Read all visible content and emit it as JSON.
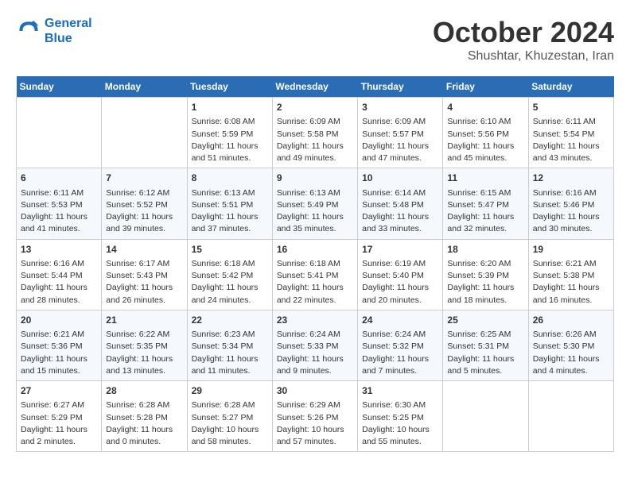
{
  "header": {
    "logo_line1": "General",
    "logo_line2": "Blue",
    "month": "October 2024",
    "location": "Shushtar, Khuzestan, Iran"
  },
  "weekdays": [
    "Sunday",
    "Monday",
    "Tuesday",
    "Wednesday",
    "Thursday",
    "Friday",
    "Saturday"
  ],
  "weeks": [
    [
      {
        "day": "",
        "empty": true
      },
      {
        "day": "",
        "empty": true
      },
      {
        "day": "1",
        "sunrise": "6:08 AM",
        "sunset": "5:59 PM",
        "daylight": "11 hours and 51 minutes."
      },
      {
        "day": "2",
        "sunrise": "6:09 AM",
        "sunset": "5:58 PM",
        "daylight": "11 hours and 49 minutes."
      },
      {
        "day": "3",
        "sunrise": "6:09 AM",
        "sunset": "5:57 PM",
        "daylight": "11 hours and 47 minutes."
      },
      {
        "day": "4",
        "sunrise": "6:10 AM",
        "sunset": "5:56 PM",
        "daylight": "11 hours and 45 minutes."
      },
      {
        "day": "5",
        "sunrise": "6:11 AM",
        "sunset": "5:54 PM",
        "daylight": "11 hours and 43 minutes."
      }
    ],
    [
      {
        "day": "6",
        "sunrise": "6:11 AM",
        "sunset": "5:53 PM",
        "daylight": "11 hours and 41 minutes."
      },
      {
        "day": "7",
        "sunrise": "6:12 AM",
        "sunset": "5:52 PM",
        "daylight": "11 hours and 39 minutes."
      },
      {
        "day": "8",
        "sunrise": "6:13 AM",
        "sunset": "5:51 PM",
        "daylight": "11 hours and 37 minutes."
      },
      {
        "day": "9",
        "sunrise": "6:13 AM",
        "sunset": "5:49 PM",
        "daylight": "11 hours and 35 minutes."
      },
      {
        "day": "10",
        "sunrise": "6:14 AM",
        "sunset": "5:48 PM",
        "daylight": "11 hours and 33 minutes."
      },
      {
        "day": "11",
        "sunrise": "6:15 AM",
        "sunset": "5:47 PM",
        "daylight": "11 hours and 32 minutes."
      },
      {
        "day": "12",
        "sunrise": "6:16 AM",
        "sunset": "5:46 PM",
        "daylight": "11 hours and 30 minutes."
      }
    ],
    [
      {
        "day": "13",
        "sunrise": "6:16 AM",
        "sunset": "5:44 PM",
        "daylight": "11 hours and 28 minutes."
      },
      {
        "day": "14",
        "sunrise": "6:17 AM",
        "sunset": "5:43 PM",
        "daylight": "11 hours and 26 minutes."
      },
      {
        "day": "15",
        "sunrise": "6:18 AM",
        "sunset": "5:42 PM",
        "daylight": "11 hours and 24 minutes."
      },
      {
        "day": "16",
        "sunrise": "6:18 AM",
        "sunset": "5:41 PM",
        "daylight": "11 hours and 22 minutes."
      },
      {
        "day": "17",
        "sunrise": "6:19 AM",
        "sunset": "5:40 PM",
        "daylight": "11 hours and 20 minutes."
      },
      {
        "day": "18",
        "sunrise": "6:20 AM",
        "sunset": "5:39 PM",
        "daylight": "11 hours and 18 minutes."
      },
      {
        "day": "19",
        "sunrise": "6:21 AM",
        "sunset": "5:38 PM",
        "daylight": "11 hours and 16 minutes."
      }
    ],
    [
      {
        "day": "20",
        "sunrise": "6:21 AM",
        "sunset": "5:36 PM",
        "daylight": "11 hours and 15 minutes."
      },
      {
        "day": "21",
        "sunrise": "6:22 AM",
        "sunset": "5:35 PM",
        "daylight": "11 hours and 13 minutes."
      },
      {
        "day": "22",
        "sunrise": "6:23 AM",
        "sunset": "5:34 PM",
        "daylight": "11 hours and 11 minutes."
      },
      {
        "day": "23",
        "sunrise": "6:24 AM",
        "sunset": "5:33 PM",
        "daylight": "11 hours and 9 minutes."
      },
      {
        "day": "24",
        "sunrise": "6:24 AM",
        "sunset": "5:32 PM",
        "daylight": "11 hours and 7 minutes."
      },
      {
        "day": "25",
        "sunrise": "6:25 AM",
        "sunset": "5:31 PM",
        "daylight": "11 hours and 5 minutes."
      },
      {
        "day": "26",
        "sunrise": "6:26 AM",
        "sunset": "5:30 PM",
        "daylight": "11 hours and 4 minutes."
      }
    ],
    [
      {
        "day": "27",
        "sunrise": "6:27 AM",
        "sunset": "5:29 PM",
        "daylight": "11 hours and 2 minutes."
      },
      {
        "day": "28",
        "sunrise": "6:28 AM",
        "sunset": "5:28 PM",
        "daylight": "11 hours and 0 minutes."
      },
      {
        "day": "29",
        "sunrise": "6:28 AM",
        "sunset": "5:27 PM",
        "daylight": "10 hours and 58 minutes."
      },
      {
        "day": "30",
        "sunrise": "6:29 AM",
        "sunset": "5:26 PM",
        "daylight": "10 hours and 57 minutes."
      },
      {
        "day": "31",
        "sunrise": "6:30 AM",
        "sunset": "5:25 PM",
        "daylight": "10 hours and 55 minutes."
      },
      {
        "day": "",
        "empty": true
      },
      {
        "day": "",
        "empty": true
      }
    ]
  ]
}
